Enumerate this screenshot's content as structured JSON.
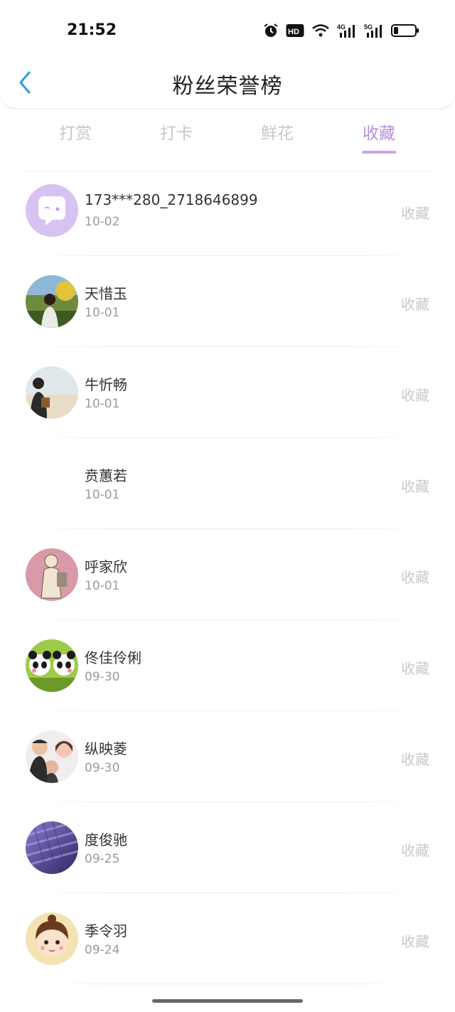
{
  "status_bar": {
    "time": "21:52"
  },
  "header": {
    "title": "粉丝荣誉榜"
  },
  "tabs": [
    {
      "label": "打赏",
      "active": false
    },
    {
      "label": "打卡",
      "active": false
    },
    {
      "label": "鲜花",
      "active": false
    },
    {
      "label": "收藏",
      "active": true
    }
  ],
  "rows": [
    {
      "name": "173***280_2718646899",
      "date": "10-02",
      "action": "收藏",
      "avatar": "default-chat-avatar"
    },
    {
      "name": "天惜玉",
      "date": "10-01",
      "action": "收藏",
      "avatar": "photo-person-outdoors"
    },
    {
      "name": "牛忻畅",
      "date": "10-01",
      "action": "收藏",
      "avatar": "photo-beach"
    },
    {
      "name": "贲蕙若",
      "date": "10-01",
      "action": "收藏",
      "avatar": "blank"
    },
    {
      "name": "呼家欣",
      "date": "10-01",
      "action": "收藏",
      "avatar": "drawing-girl"
    },
    {
      "name": "佟佳伶俐",
      "date": "09-30",
      "action": "收藏",
      "avatar": "cartoon-pandas"
    },
    {
      "name": "纵映菱",
      "date": "09-30",
      "action": "收藏",
      "avatar": "photo-faces"
    },
    {
      "name": "度俊驰",
      "date": "09-25",
      "action": "收藏",
      "avatar": "purple-texture"
    },
    {
      "name": "季令羽",
      "date": "09-24",
      "action": "收藏",
      "avatar": "cartoon-girl"
    }
  ],
  "colors": {
    "accent": "#b98ee0",
    "inactive_tab": "#c8c8c8",
    "back_arrow": "#2a9ee0"
  }
}
